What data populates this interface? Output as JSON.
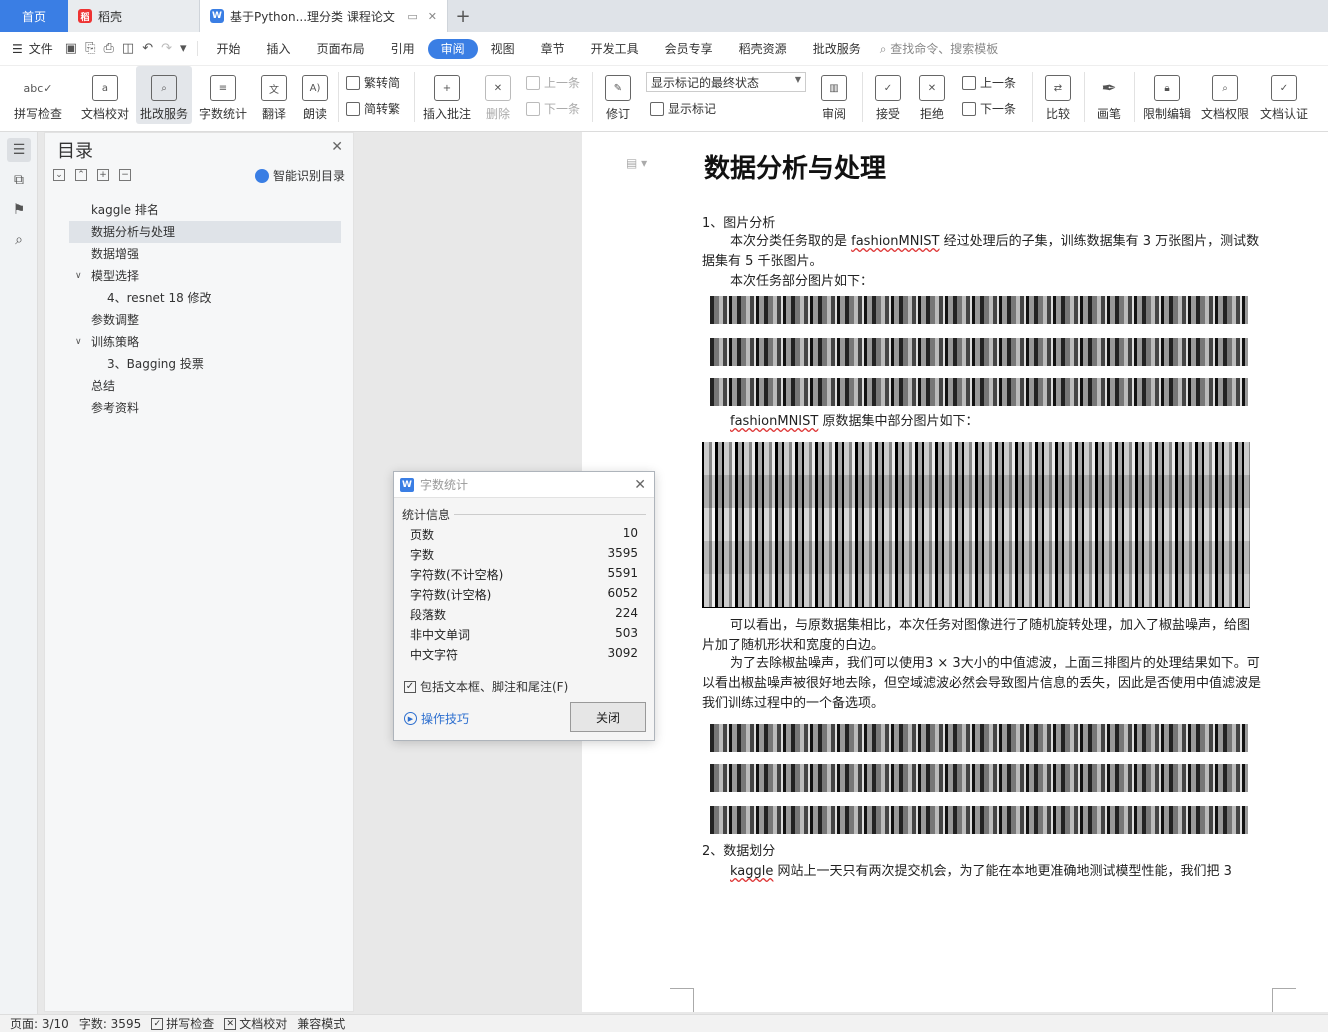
{
  "tabs": {
    "home": "首页",
    "daoke": "稻壳",
    "doc": "基于Python...理分类 课程论文"
  },
  "menu": {
    "file": "文件",
    "items": [
      "开始",
      "插入",
      "页面布局",
      "引用",
      "审阅",
      "视图",
      "章节",
      "开发工具",
      "会员专享",
      "稻壳资源",
      "批改服务"
    ],
    "active_index": 4,
    "search": "查找命令、搜索模板"
  },
  "ribbon": {
    "spell": "拼写检查",
    "proof": "文档校对",
    "correction": "批改服务",
    "wordcount": "字数统计",
    "translate": "翻译",
    "read": "朗读",
    "trad": "繁转简",
    "simp": "简转繁",
    "insert_comment": "插入批注",
    "delete": "删除",
    "prev1": "上一条",
    "next1": "下一条",
    "revise": "修订",
    "markup_state": "显示标记的最终状态",
    "show_markup": "显示标记",
    "review": "审阅",
    "accept": "接受",
    "reject": "拒绝",
    "prev2": "上一条",
    "next2": "下一条",
    "compare": "比较",
    "pen": "画笔",
    "restrict": "限制编辑",
    "rights": "文档权限",
    "auth": "文档认证"
  },
  "toc": {
    "title": "目录",
    "smart": "智能识别目录",
    "items": [
      {
        "label": "kaggle 排名",
        "level": 1
      },
      {
        "label": "数据分析与处理",
        "level": 1,
        "selected": true
      },
      {
        "label": "数据增强",
        "level": 1
      },
      {
        "label": "模型选择",
        "level": 1,
        "expanded": true
      },
      {
        "label": "4、resnet 18 修改",
        "level": 2
      },
      {
        "label": "参数调整",
        "level": 1
      },
      {
        "label": "训练策略",
        "level": 1,
        "expanded": true
      },
      {
        "label": "3、Bagging 投票",
        "level": 2
      },
      {
        "label": "总结",
        "level": 1
      },
      {
        "label": "参考资料",
        "level": 1
      }
    ]
  },
  "doc": {
    "title": "数据分析与处理",
    "s1": "1、图片分析",
    "p1a": "本次分类任务取的是 ",
    "p1w": "fashionMNIST",
    "p1b": " 经过处理后的子集，训练数据集有 3 万张图片，测试数据集有 5 千张图片。",
    "p2": "本次任务部分图片如下：",
    "p3w": "fashionMNIST",
    "p3b": " 原数据集中部分图片如下：",
    "p4": "可以看出，与原数据集相比，本次任务对图像进行了随机旋转处理，加入了椒盐噪声，给图片加了随机形状和宽度的白边。",
    "p5": "为了去除椒盐噪声，我们可以使用3 × 3大小的中值滤波，上面三排图片的处理结果如下。可以看出椒盐噪声被很好地去除，但空域滤波必然会导致图片信息的丢失，因此是否使用中值滤波是我们训练过程中的一个备选项。",
    "s2": "2、数据划分",
    "p6w": "kaggle",
    "p6b": " 网站上一天只有两次提交机会，为了能在本地更准确地测试模型性能，我们把 3"
  },
  "dialog": {
    "title": "字数统计",
    "section": "统计信息",
    "stats": [
      {
        "label": "页数",
        "value": "10"
      },
      {
        "label": "字数",
        "value": "3595"
      },
      {
        "label": "字符数(不计空格)",
        "value": "5591"
      },
      {
        "label": "字符数(计空格)",
        "value": "6052"
      },
      {
        "label": "段落数",
        "value": "224"
      },
      {
        "label": "非中文单词",
        "value": "503"
      },
      {
        "label": "中文字符",
        "value": "3092"
      }
    ],
    "include": "包括文本框、脚注和尾注(F)",
    "include_checked": true,
    "tips": "操作技巧",
    "close": "关闭"
  },
  "status": {
    "page": "页面: 3/10",
    "words": "字数: 3595",
    "spell": "拼写检查",
    "proof": "文档校对",
    "compat": "兼容模式"
  },
  "colors": {
    "accent": "#3a7ee4",
    "link": "#2d6fcf"
  }
}
